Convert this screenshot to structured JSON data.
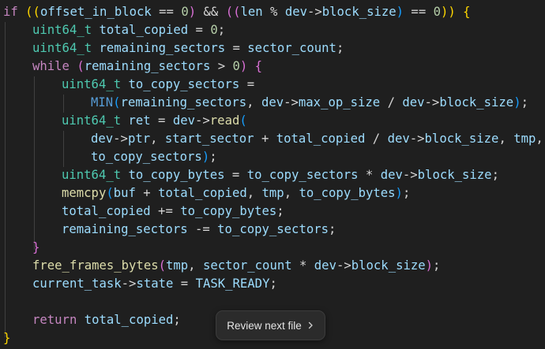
{
  "editor": {
    "lines": [
      [
        [
          "if ",
          "tok-kw"
        ],
        [
          "((",
          "tok-b1"
        ],
        [
          "offset_in_block",
          "tok-var"
        ],
        [
          " == ",
          "tok-op"
        ],
        [
          "0",
          "tok-num"
        ],
        [
          ")",
          "tok-b2"
        ],
        [
          " && ",
          "tok-op"
        ],
        [
          "((",
          "tok-b2"
        ],
        [
          "len",
          "tok-var"
        ],
        [
          " % ",
          "tok-op"
        ],
        [
          "dev",
          "tok-var"
        ],
        [
          "->",
          "tok-op"
        ],
        [
          "block_size",
          "tok-var"
        ],
        [
          ")",
          "tok-b3"
        ],
        [
          " == ",
          "tok-op"
        ],
        [
          "0",
          "tok-num"
        ],
        [
          "))",
          "tok-b1"
        ],
        [
          " {",
          "tok-b1"
        ]
      ],
      [
        [
          "uint64_t",
          "tok-type"
        ],
        [
          " total_copied",
          "tok-var"
        ],
        [
          " = ",
          "tok-op"
        ],
        [
          "0",
          "tok-num"
        ],
        [
          ";",
          "tok-plain"
        ]
      ],
      [
        [
          "uint64_t",
          "tok-type"
        ],
        [
          " remaining_sectors",
          "tok-var"
        ],
        [
          " = ",
          "tok-op"
        ],
        [
          "sector_count",
          "tok-var"
        ],
        [
          ";",
          "tok-plain"
        ]
      ],
      [
        [
          "while",
          "tok-ctl"
        ],
        [
          " (",
          "tok-b2"
        ],
        [
          "remaining_sectors",
          "tok-var"
        ],
        [
          " > ",
          "tok-op"
        ],
        [
          "0",
          "tok-num"
        ],
        [
          ")",
          "tok-b2"
        ],
        [
          " {",
          "tok-b2"
        ]
      ],
      [
        [
          "uint64_t",
          "tok-type"
        ],
        [
          " to_copy_sectors",
          "tok-var"
        ],
        [
          " =",
          "tok-op"
        ]
      ],
      [
        [
          "MIN",
          "tok-macro"
        ],
        [
          "(",
          "tok-b3"
        ],
        [
          "remaining_sectors",
          "tok-var"
        ],
        [
          ", ",
          "tok-plain"
        ],
        [
          "dev",
          "tok-var"
        ],
        [
          "->",
          "tok-op"
        ],
        [
          "max_op_size",
          "tok-var"
        ],
        [
          " / ",
          "tok-op"
        ],
        [
          "dev",
          "tok-var"
        ],
        [
          "->",
          "tok-op"
        ],
        [
          "block_size",
          "tok-var"
        ],
        [
          ")",
          "tok-b3"
        ],
        [
          ";",
          "tok-plain"
        ]
      ],
      [
        [
          "uint64_t",
          "tok-type"
        ],
        [
          " ret",
          "tok-var"
        ],
        [
          " = ",
          "tok-op"
        ],
        [
          "dev",
          "tok-var"
        ],
        [
          "->",
          "tok-op"
        ],
        [
          "read",
          "tok-fn"
        ],
        [
          "(",
          "tok-b3"
        ]
      ],
      [
        [
          "dev",
          "tok-var"
        ],
        [
          "->",
          "tok-op"
        ],
        [
          "ptr",
          "tok-var"
        ],
        [
          ", ",
          "tok-plain"
        ],
        [
          "start_sector",
          "tok-var"
        ],
        [
          " + ",
          "tok-op"
        ],
        [
          "total_copied",
          "tok-var"
        ],
        [
          " / ",
          "tok-op"
        ],
        [
          "dev",
          "tok-var"
        ],
        [
          "->",
          "tok-op"
        ],
        [
          "block_size",
          "tok-var"
        ],
        [
          ", ",
          "tok-plain"
        ],
        [
          "tmp",
          "tok-var"
        ],
        [
          ",",
          "tok-plain"
        ]
      ],
      [
        [
          "to_copy_sectors",
          "tok-var"
        ],
        [
          ")",
          "tok-b3"
        ],
        [
          ";",
          "tok-plain"
        ]
      ],
      [
        [
          "uint64_t",
          "tok-type"
        ],
        [
          " to_copy_bytes",
          "tok-var"
        ],
        [
          " = ",
          "tok-op"
        ],
        [
          "to_copy_sectors",
          "tok-var"
        ],
        [
          " * ",
          "tok-op"
        ],
        [
          "dev",
          "tok-var"
        ],
        [
          "->",
          "tok-op"
        ],
        [
          "block_size",
          "tok-var"
        ],
        [
          ";",
          "tok-plain"
        ]
      ],
      [
        [
          "memcpy",
          "tok-fn"
        ],
        [
          "(",
          "tok-b3"
        ],
        [
          "buf",
          "tok-var"
        ],
        [
          " + ",
          "tok-op"
        ],
        [
          "total_copied",
          "tok-var"
        ],
        [
          ", ",
          "tok-plain"
        ],
        [
          "tmp",
          "tok-var"
        ],
        [
          ", ",
          "tok-plain"
        ],
        [
          "to_copy_bytes",
          "tok-var"
        ],
        [
          ")",
          "tok-b3"
        ],
        [
          ";",
          "tok-plain"
        ]
      ],
      [
        [
          "total_copied",
          "tok-var"
        ],
        [
          " += ",
          "tok-op"
        ],
        [
          "to_copy_bytes",
          "tok-var"
        ],
        [
          ";",
          "tok-plain"
        ]
      ],
      [
        [
          "remaining_sectors",
          "tok-var"
        ],
        [
          " -= ",
          "tok-op"
        ],
        [
          "to_copy_sectors",
          "tok-var"
        ],
        [
          ";",
          "tok-plain"
        ]
      ],
      [
        [
          "}",
          "tok-b2"
        ]
      ],
      [
        [
          "free_frames_bytes",
          "tok-fn"
        ],
        [
          "(",
          "tok-b2"
        ],
        [
          "tmp",
          "tok-var"
        ],
        [
          ", ",
          "tok-plain"
        ],
        [
          "sector_count",
          "tok-var"
        ],
        [
          " * ",
          "tok-op"
        ],
        [
          "dev",
          "tok-var"
        ],
        [
          "->",
          "tok-op"
        ],
        [
          "block_size",
          "tok-var"
        ],
        [
          ")",
          "tok-b2"
        ],
        [
          ";",
          "tok-plain"
        ]
      ],
      [
        [
          "current_task",
          "tok-var"
        ],
        [
          "->",
          "tok-op"
        ],
        [
          "state",
          "tok-var"
        ],
        [
          " = ",
          "tok-op"
        ],
        [
          "TASK_READY",
          "tok-var"
        ],
        [
          ";",
          "tok-plain"
        ]
      ],
      [],
      [
        [
          "return",
          "tok-ctl"
        ],
        [
          " total_copied",
          "tok-var"
        ],
        [
          ";",
          "tok-plain"
        ]
      ],
      [
        [
          "}",
          "tok-b1"
        ]
      ]
    ]
  },
  "review_button": {
    "label": "Review next file",
    "icon": "chevron-right-icon"
  }
}
